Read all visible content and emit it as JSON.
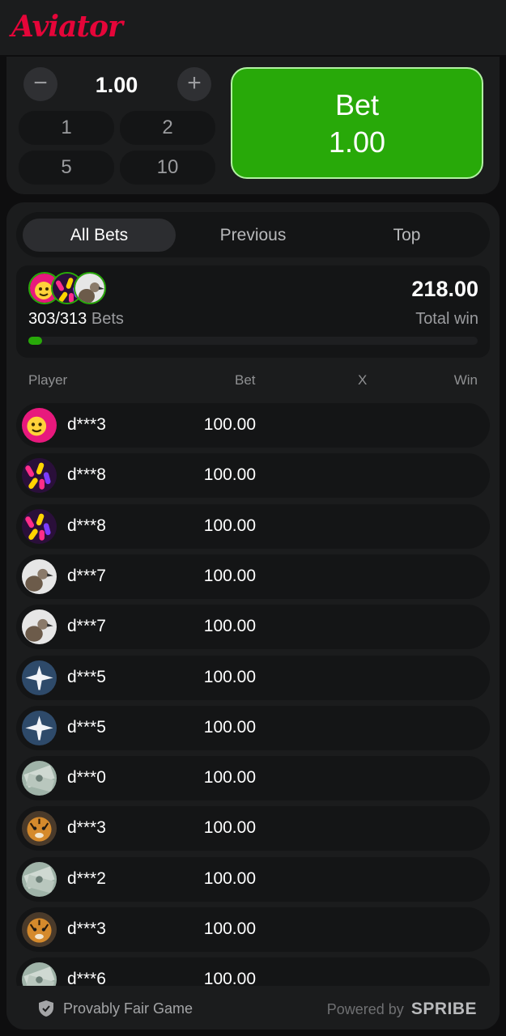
{
  "brand": {
    "logo_text": "Aviator",
    "accent": "#e50539",
    "bet_green": "#28a909"
  },
  "bet_controls": {
    "minus_label": "−",
    "plus_label": "+",
    "amount": "1.00",
    "quick_amounts": [
      "1",
      "2",
      "5",
      "10"
    ],
    "bet_button_label": "Bet",
    "bet_button_amount": "1.00"
  },
  "tabs": [
    {
      "label": "All Bets",
      "active": true
    },
    {
      "label": "Previous",
      "active": false
    },
    {
      "label": "Top",
      "active": false
    }
  ],
  "summary": {
    "bets_count": "303/313",
    "bets_label": "Bets",
    "total_win": "218.00",
    "total_label": "Total win",
    "progress_fraction": 0.03,
    "avatar_icons": [
      "emoji-avatar-icon",
      "candy-avatar-icon",
      "vulture-avatar-icon"
    ]
  },
  "columns": {
    "player": "Player",
    "bet": "Bet",
    "x": "X",
    "win": "Win"
  },
  "rows": [
    {
      "player": "d***3",
      "bet": "100.00",
      "avatar": "emoji-avatar-icon"
    },
    {
      "player": "d***8",
      "bet": "100.00",
      "avatar": "candy-avatar-icon"
    },
    {
      "player": "d***8",
      "bet": "100.00",
      "avatar": "candy-avatar-icon"
    },
    {
      "player": "d***7",
      "bet": "100.00",
      "avatar": "vulture-avatar-icon"
    },
    {
      "player": "d***7",
      "bet": "100.00",
      "avatar": "vulture-avatar-icon"
    },
    {
      "player": "d***5",
      "bet": "100.00",
      "avatar": "plane-avatar-icon"
    },
    {
      "player": "d***5",
      "bet": "100.00",
      "avatar": "plane-avatar-icon"
    },
    {
      "player": "d***0",
      "bet": "100.00",
      "avatar": "money-avatar-icon"
    },
    {
      "player": "d***3",
      "bet": "100.00",
      "avatar": "tiger-avatar-icon"
    },
    {
      "player": "d***2",
      "bet": "100.00",
      "avatar": "money-avatar-icon"
    },
    {
      "player": "d***3",
      "bet": "100.00",
      "avatar": "tiger-avatar-icon"
    },
    {
      "player": "d***6",
      "bet": "100.00",
      "avatar": "money-avatar-icon"
    }
  ],
  "footer": {
    "provably_fair": "Provably Fair Game",
    "powered_by": "Powered by",
    "provider": "SPRIBE"
  }
}
